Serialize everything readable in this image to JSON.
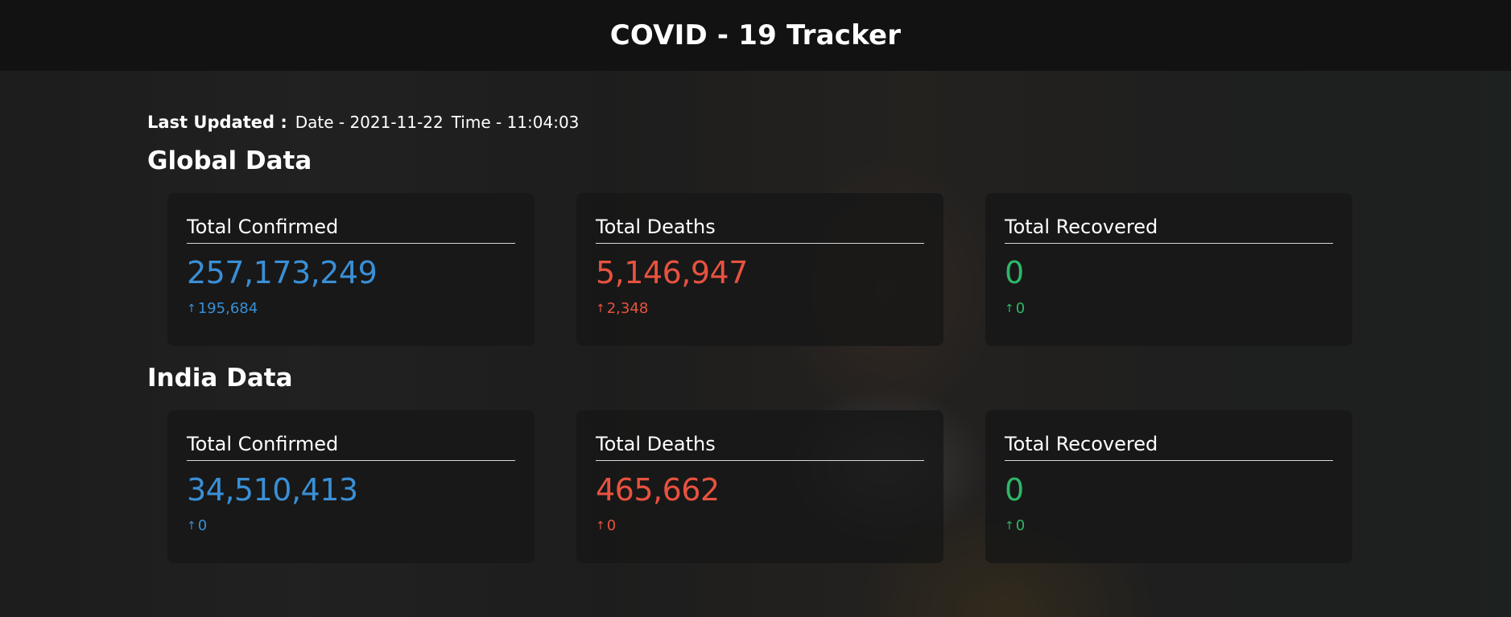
{
  "header": {
    "title": "COVID - 19 Tracker"
  },
  "last_updated": {
    "label": "Last Updated :",
    "date": "Date - 2021-11-22",
    "time": "Time - 11:04:03"
  },
  "colors": {
    "confirmed": "#3a8fd6",
    "deaths": "#e8523f",
    "recovered": "#2fb768"
  },
  "global": {
    "title": "Global Data",
    "confirmed": {
      "label": "Total Confirmed",
      "value": "257,173,249",
      "delta": "195,684"
    },
    "deaths": {
      "label": "Total Deaths",
      "value": "5,146,947",
      "delta": "2,348"
    },
    "recovered": {
      "label": "Total Recovered",
      "value": "0",
      "delta": "0"
    }
  },
  "india": {
    "title": "India Data",
    "confirmed": {
      "label": "Total Confirmed",
      "value": "34,510,413",
      "delta": "0"
    },
    "deaths": {
      "label": "Total Deaths",
      "value": "465,662",
      "delta": "0"
    },
    "recovered": {
      "label": "Total Recovered",
      "value": "0",
      "delta": "0"
    }
  },
  "icons": {
    "delta_arrow": "arrow-up-icon",
    "delta_glyph": "↑"
  }
}
